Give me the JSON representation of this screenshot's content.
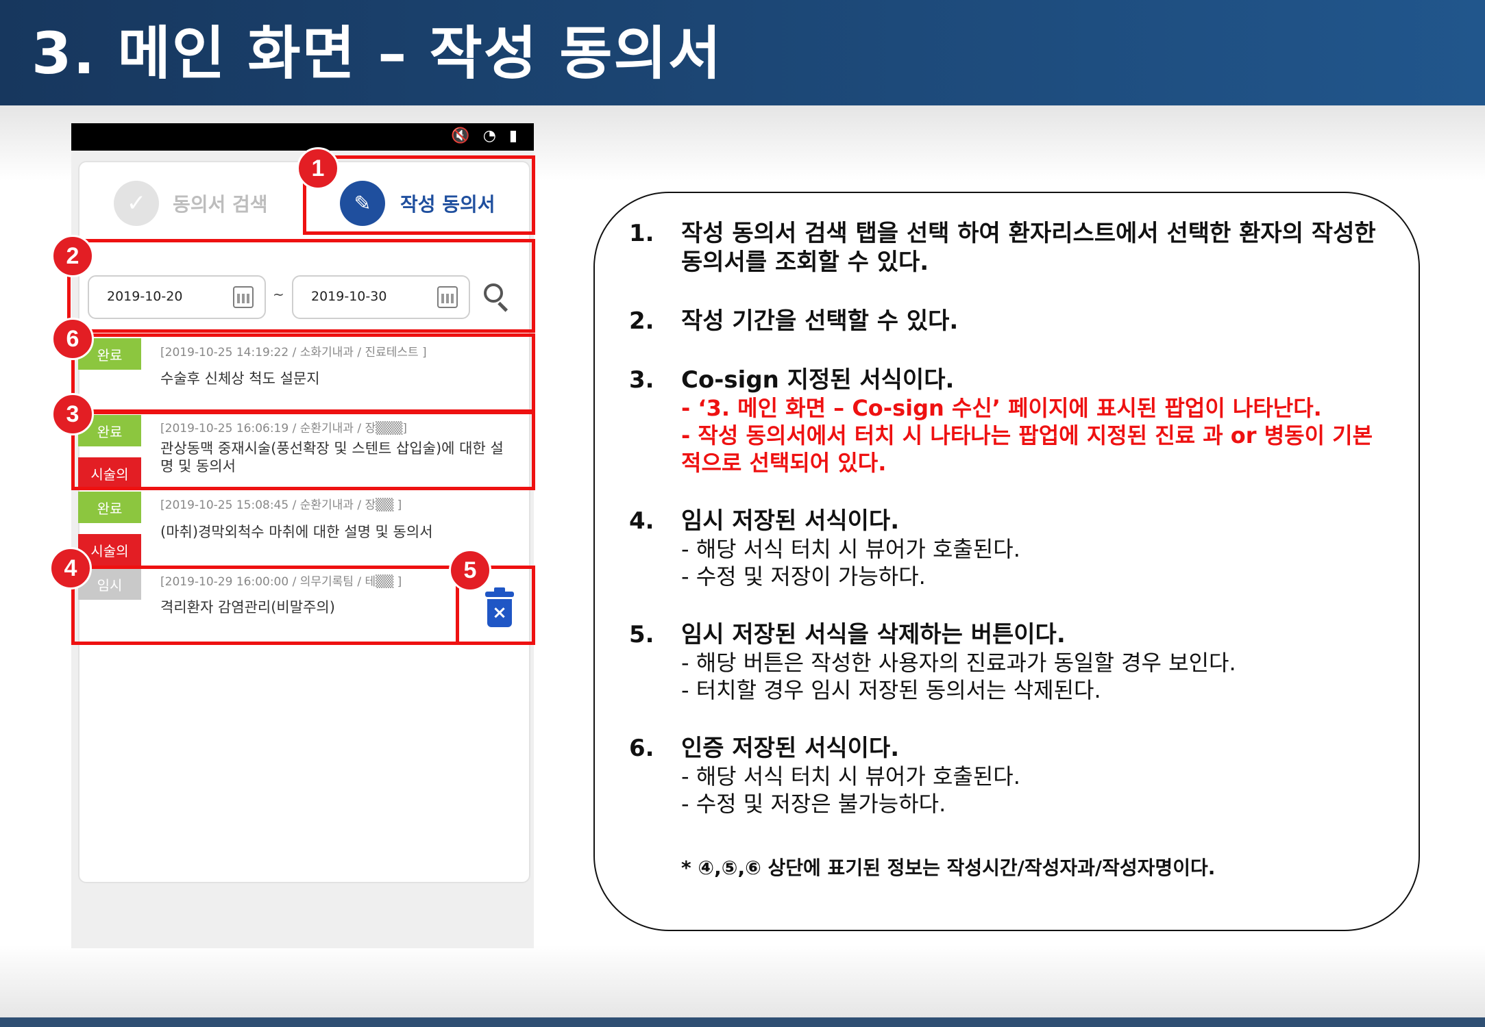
{
  "slide": {
    "title": "3. 메인 화면 – 작성 동의서"
  },
  "status_icons": "🔇 ◔ ▮",
  "tabs": {
    "search_label": "동의서 검색",
    "write_label": "작성 동의서"
  },
  "dates": {
    "from": "2019-10-20",
    "separator": "~",
    "to": "2019-10-30"
  },
  "rows": [
    {
      "badges": [
        "완료"
      ],
      "meta": "[2019-10-25 14:19:22 / 소화기내과 / 진료테스트 ]",
      "title": "수술후 신체상 척도 설문지"
    },
    {
      "badges": [
        "완료",
        "시술의"
      ],
      "meta": "[2019-10-25 16:06:19 / 순환기내과 / 장▒▒▒]",
      "title": "관상동맥 중재시술(풍선확장 및 스텐트 삽입술)에 대한 설명 및 동의서"
    },
    {
      "badges": [
        "완료",
        "시술의"
      ],
      "meta": "[2019-10-25 15:08:45 / 순환기내과 / 장▒▒ ]",
      "title": "(마취)경막외척수 마취에 대한 설명 및 동의서"
    },
    {
      "badges": [
        "임시"
      ],
      "meta": "[2019-10-29 16:00:00 / 의무기록팀 / 테▒▒ ]",
      "title": "격리환자 감염관리(비말주의)"
    }
  ],
  "markers": [
    "1",
    "2",
    "3",
    "4",
    "5",
    "6"
  ],
  "trash_symbol": "×",
  "descriptions": [
    {
      "num": "1.",
      "head": "작성 동의서 검색 탭을 선택 하여 환자리스트에서 선택한 환자의 작성한 동의서를 조회할 수 있다.",
      "red": [],
      "lines": []
    },
    {
      "num": "2.",
      "head": "작성 기간을 선택할 수 있다.",
      "red": [],
      "lines": []
    },
    {
      "num": "3.",
      "head": "Co-sign 지정된 서식이다.",
      "red": [
        "- ‘3. 메인 화면 – Co-sign 수신’ 페이지에 표시된 팝업이 나타난다.",
        "- 작성 동의서에서 터치 시 나타나는 팝업에 지정된 진료 과 or 병동이 기본적으로 선택되어 있다."
      ],
      "lines": []
    },
    {
      "num": "4.",
      "head": "임시 저장된 서식이다.",
      "red": [],
      "lines": [
        "- 해당 서식 터치 시 뷰어가 호출된다.",
        "- 수정 및 저장이 가능하다."
      ]
    },
    {
      "num": "5.",
      "head": "임시 저장된 서식을 삭제하는 버튼이다.",
      "red": [],
      "lines": [
        "- 해당 버튼은 작성한 사용자의 진료과가 동일할 경우 보인다.",
        "- 터치할 경우 임시 저장된 동의서는 삭제된다."
      ]
    },
    {
      "num": "6.",
      "head": "인증 저장된 서식이다.",
      "red": [],
      "lines": [
        "- 해당 서식 터치 시 뷰어가 호출된다.",
        "- 수정 및 저장은 불가능하다."
      ]
    }
  ],
  "note": "* ④,⑤,⑥ 상단에 표기된 정보는 작성시간/작성자과/작성자명이다."
}
